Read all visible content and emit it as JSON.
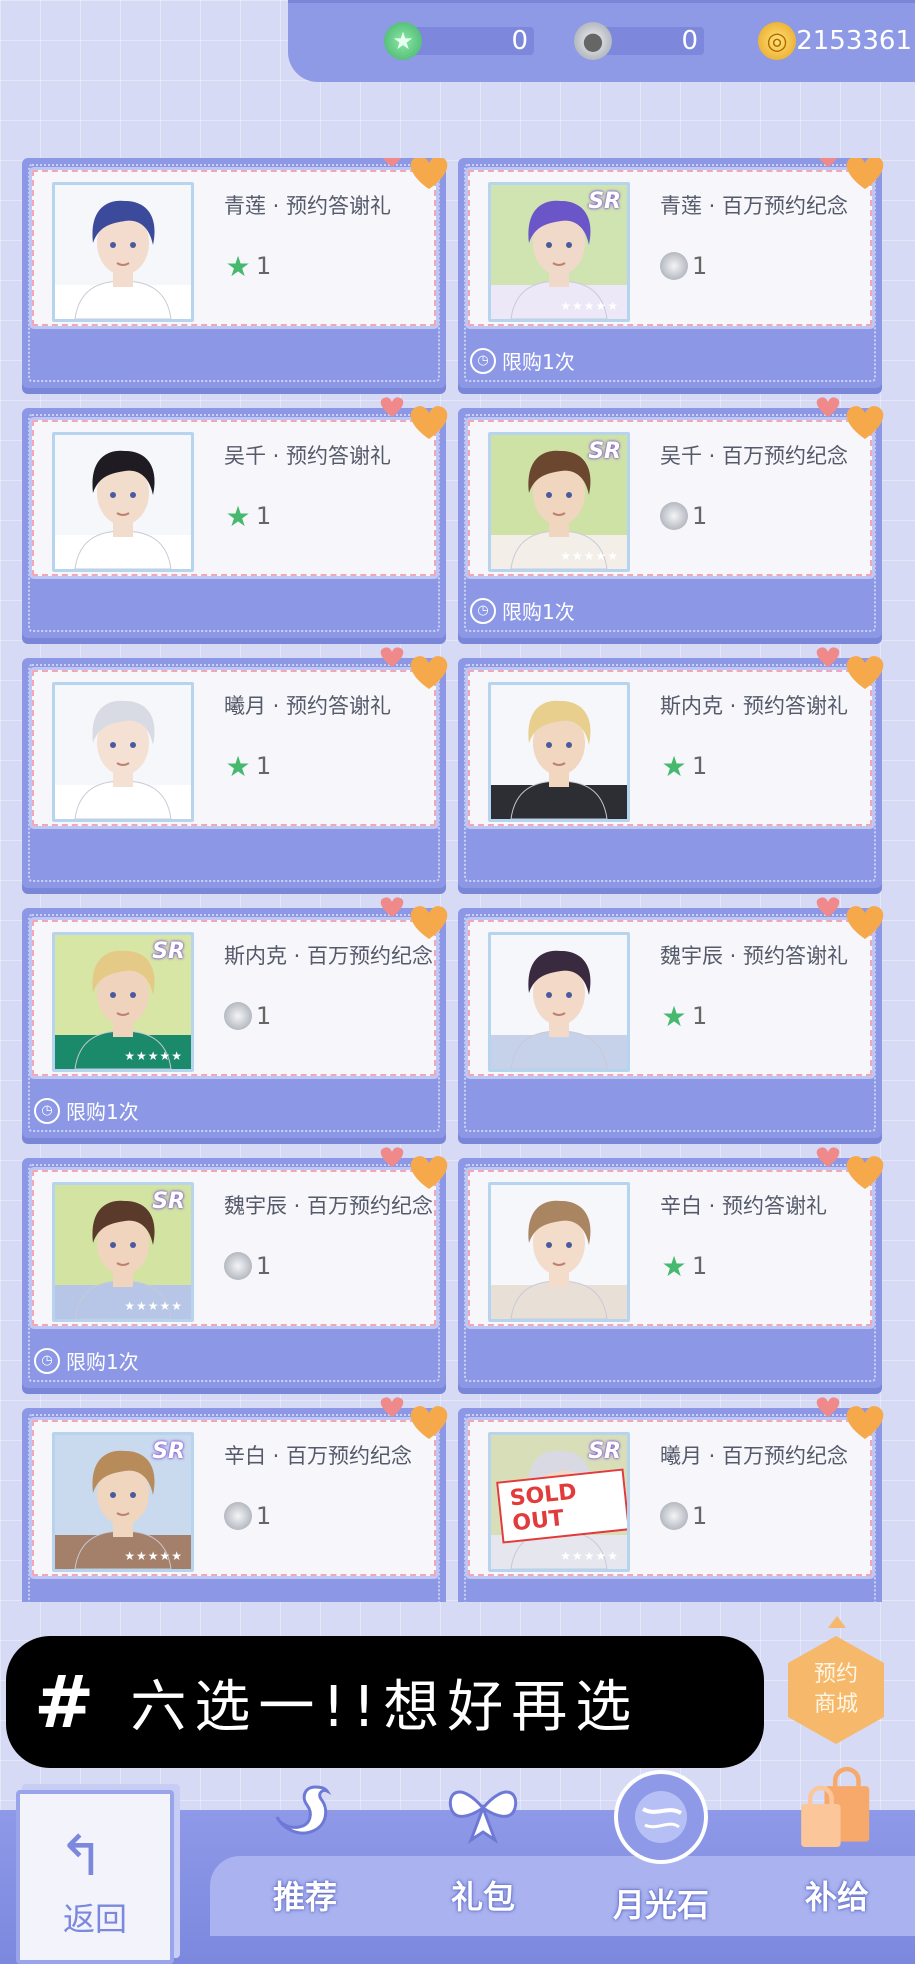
{
  "currencies": [
    {
      "icon": "green-star-icon",
      "value": "0"
    },
    {
      "icon": "moonstone-icon",
      "value": "0"
    },
    {
      "icon": "gold-coin-icon",
      "value": "2153361"
    }
  ],
  "items": [
    {
      "name": "青莲 · 预约答谢礼",
      "price_icon": "star",
      "price": "1",
      "limit": "",
      "sr": false,
      "sold_out": false,
      "hair": "#3b4a9a",
      "skin": "#f3dccd",
      "shirt": "#ffffff",
      "bgc": "#f5f7fb"
    },
    {
      "name": "青莲 · 百万预约纪念",
      "price_icon": "stone",
      "price": "1",
      "limit": "限购1次",
      "sr": true,
      "sold_out": false,
      "hair": "#6a56c8",
      "skin": "#f1d9c9",
      "shirt": "#ece8f7",
      "bgc": "#cfe4b0"
    },
    {
      "name": "吴千 · 预约答谢礼",
      "price_icon": "star",
      "price": "1",
      "limit": "",
      "sr": false,
      "sold_out": false,
      "hair": "#1e1b22",
      "skin": "#f2dccb",
      "shirt": "#ffffff",
      "bgc": "#f5f7fb"
    },
    {
      "name": "吴千 · 百万预约纪念",
      "price_icon": "stone",
      "price": "1",
      "limit": "限购1次",
      "sr": true,
      "sold_out": false,
      "hair": "#6b4730",
      "skin": "#f0d5bf",
      "shirt": "#f3efe8",
      "bgc": "#cfe2a6"
    },
    {
      "name": "曦月 · 预约答谢礼",
      "price_icon": "star",
      "price": "1",
      "limit": "",
      "sr": false,
      "sold_out": false,
      "hair": "#d9dbe4",
      "skin": "#f4e1d4",
      "shirt": "#ffffff",
      "bgc": "#f5f7fb"
    },
    {
      "name": "斯内克 · 预约答谢礼",
      "price_icon": "star",
      "price": "1",
      "limit": "",
      "sr": false,
      "sold_out": false,
      "hair": "#e8cf8e",
      "skin": "#f1d6c0",
      "shirt": "#2c2e34",
      "bgc": "#f5f7fb"
    },
    {
      "name": "斯内克 · 百万预约纪念",
      "price_icon": "stone",
      "price": "1",
      "limit": "限购1次",
      "sr": true,
      "sold_out": false,
      "hair": "#e5c986",
      "skin": "#efd3bd",
      "shirt": "#1b8a6b",
      "bgc": "#d7e6a5"
    },
    {
      "name": "魏宇辰 · 预约答谢礼",
      "price_icon": "star",
      "price": "1",
      "limit": "",
      "sr": false,
      "sold_out": false,
      "hair": "#3a2a40",
      "skin": "#f3dac8",
      "shirt": "#c6d2ea",
      "bgc": "#f5f7fb"
    },
    {
      "name": "魏宇辰 · 百万预约纪念",
      "price_icon": "stone",
      "price": "1",
      "limit": "限购1次",
      "sr": true,
      "sold_out": false,
      "hair": "#5a3a2a",
      "skin": "#f0d4be",
      "shirt": "#b7c6e6",
      "bgc": "#d2e3a2"
    },
    {
      "name": "辛白 · 预约答谢礼",
      "price_icon": "star",
      "price": "1",
      "limit": "",
      "sr": false,
      "sold_out": false,
      "hair": "#a98562",
      "skin": "#f3dcca",
      "shirt": "#e8e0d6",
      "bgc": "#f5f7fb"
    },
    {
      "name": "辛白 · 百万预约纪念",
      "price_icon": "stone",
      "price": "1",
      "limit": "",
      "sr": true,
      "sold_out": false,
      "hair": "#b88c5a",
      "skin": "#f0d5bf",
      "shirt": "#a4806a",
      "bgc": "#c9d9ee"
    },
    {
      "name": "曦月 · 百万预约纪念",
      "price_icon": "stone",
      "price": "1",
      "limit": "",
      "sr": true,
      "sold_out": true,
      "sold_out_text": "SOLD OUT",
      "hair": "#d8d9e2",
      "skin": "#f0d9c8",
      "shirt": "#e6e6ee",
      "bgc": "#d8dfb8"
    }
  ],
  "caption": {
    "hash": "#",
    "text": "六选一!!想好再选"
  },
  "shop_badge": {
    "line1": "预约",
    "line2": "商城"
  },
  "back": {
    "label": "返回"
  },
  "nav": [
    {
      "label": "推荐",
      "icon": "swan-icon"
    },
    {
      "label": "礼包",
      "icon": "gift-bow-icon"
    },
    {
      "label": "月光石",
      "icon": "moonstone-orb-icon"
    },
    {
      "label": "补给",
      "icon": "shopping-bag-icon"
    }
  ],
  "colors": {
    "accent": "#8c98e6",
    "heart": "#f5a94a",
    "card_border": "#f0a8b8",
    "star": "#46b96e"
  }
}
